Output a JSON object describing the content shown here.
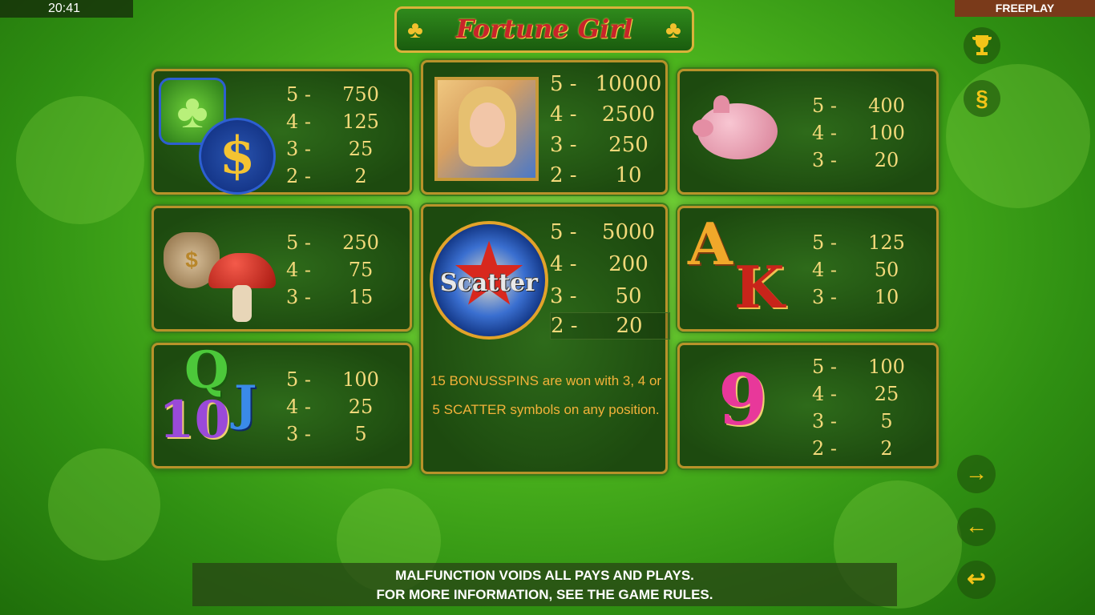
{
  "status": {
    "time": "20:41",
    "mode": "FREEPLAY"
  },
  "logo": {
    "title": "Fortune Girl"
  },
  "paytable": {
    "clover_dollar": {
      "rows": [
        [
          "5 -",
          "750"
        ],
        [
          "4 -",
          "125"
        ],
        [
          "3 -",
          "25"
        ],
        [
          "2 -",
          "2"
        ]
      ],
      "dollar": "$"
    },
    "girl": {
      "rows": [
        [
          "5 -",
          "10000"
        ],
        [
          "4 -",
          "2500"
        ],
        [
          "3 -",
          "250"
        ],
        [
          "2 -",
          "10"
        ]
      ]
    },
    "pig": {
      "rows": [
        [
          "5 -",
          "400"
        ],
        [
          "4 -",
          "100"
        ],
        [
          "3 -",
          "20"
        ]
      ]
    },
    "bag_mushroom": {
      "rows": [
        [
          "5 -",
          "250"
        ],
        [
          "4 -",
          "75"
        ],
        [
          "3 -",
          "15"
        ]
      ],
      "bag_mark": "$"
    },
    "scatter": {
      "label": "Scatter",
      "rows": [
        [
          "5 -",
          "5000"
        ],
        [
          "4 -",
          "200"
        ],
        [
          "3 -",
          "50"
        ],
        [
          "2 -",
          "20"
        ]
      ],
      "description": "15 BONUSSPINS are won with 3, 4 or 5 SCATTER symbols on any position."
    },
    "ak": {
      "letters": [
        "A",
        "K"
      ],
      "rows": [
        [
          "5 -",
          "125"
        ],
        [
          "4 -",
          "50"
        ],
        [
          "3 -",
          "10"
        ]
      ]
    },
    "qj10": {
      "letters": [
        "Q",
        "J",
        "10"
      ],
      "rows": [
        [
          "5 -",
          "100"
        ],
        [
          "4 -",
          "25"
        ],
        [
          "3 -",
          "5"
        ]
      ]
    },
    "nine": {
      "letter": "9",
      "rows": [
        [
          "5 -",
          "100"
        ],
        [
          "4 -",
          "25"
        ],
        [
          "3 -",
          "5"
        ],
        [
          "2 -",
          "2"
        ]
      ]
    }
  },
  "side_buttons": {
    "trophy": "trophy-icon",
    "rules": "§",
    "next": "→",
    "prev": "←",
    "back": "↩"
  },
  "footer": {
    "line1": "MALFUNCTION VOIDS ALL PAYS AND PLAYS.",
    "line2": "FOR MORE INFORMATION, SEE THE GAME RULES."
  },
  "colors": {
    "accent_gold": "#f3d97a",
    "desc_orange": "#f3b23a",
    "frame": "#b8922a"
  }
}
